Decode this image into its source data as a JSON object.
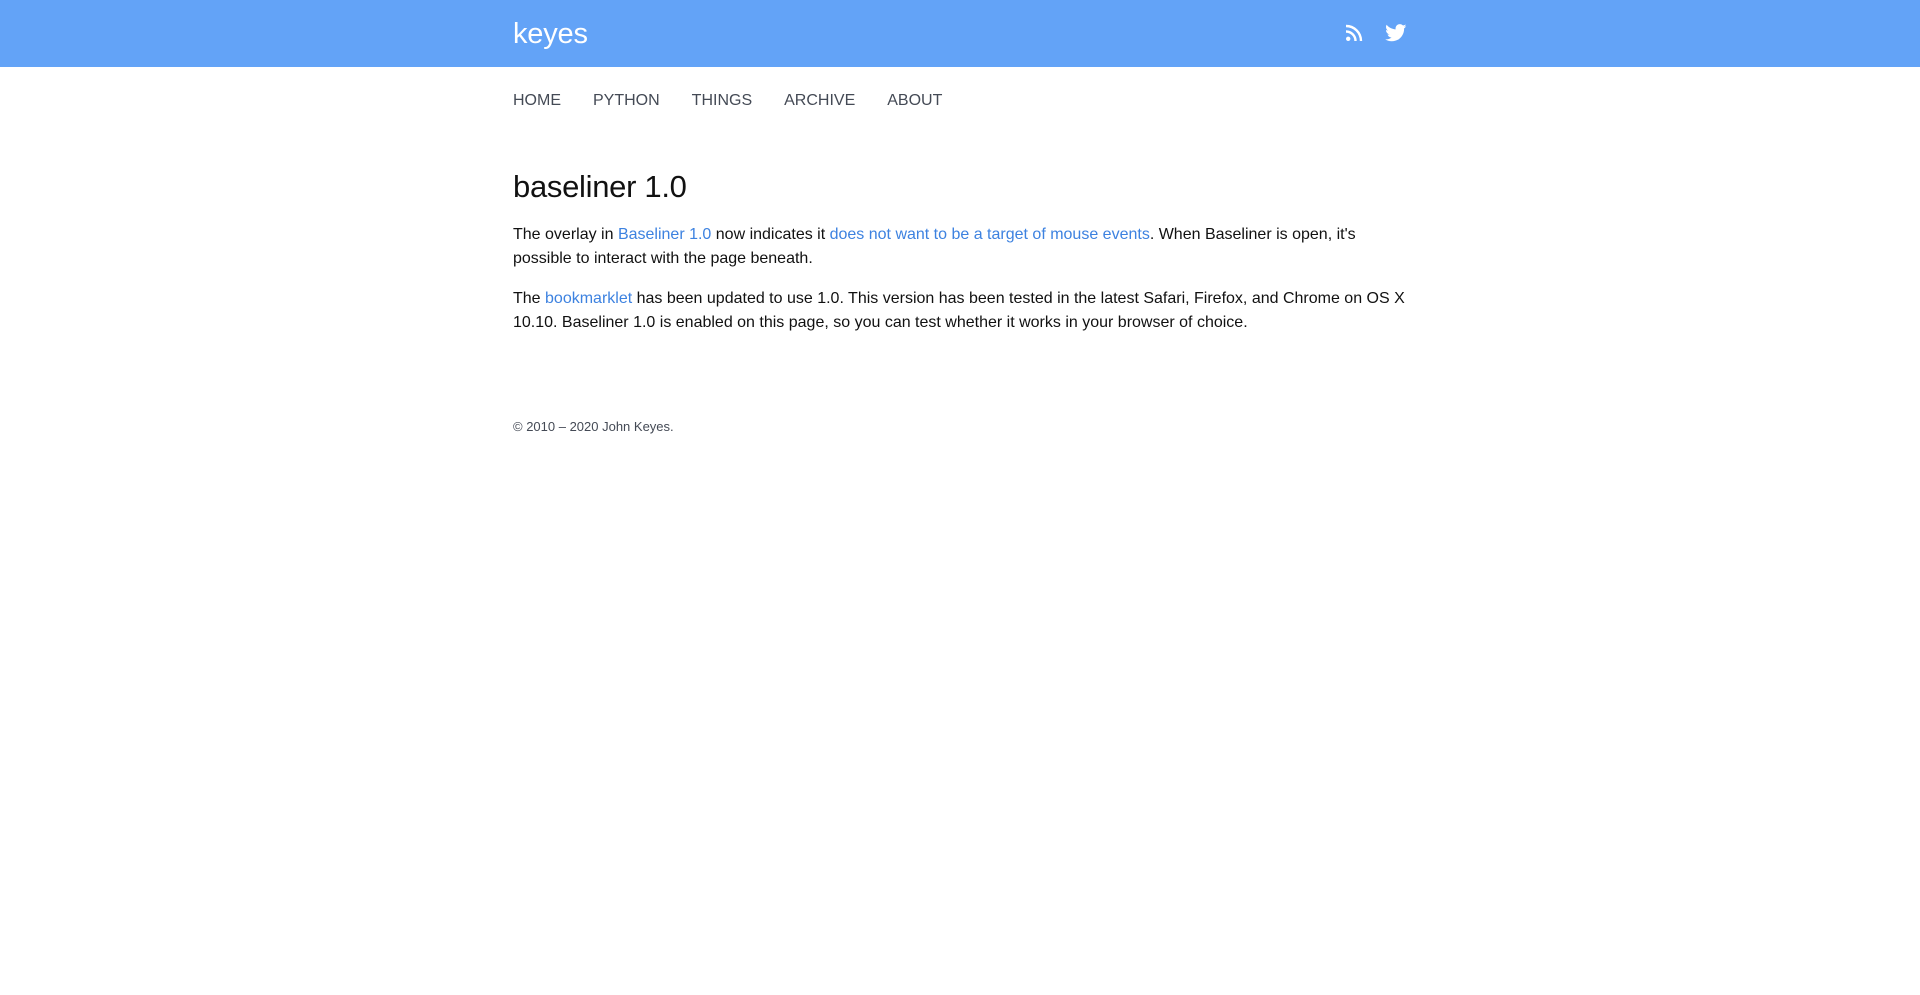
{
  "header": {
    "site_title": "keyes",
    "icons": [
      "rss-icon",
      "twitter-icon"
    ],
    "background_color": "#63a3f7"
  },
  "nav": {
    "items": [
      {
        "label": "HOME"
      },
      {
        "label": "PYTHON"
      },
      {
        "label": "THINGS"
      },
      {
        "label": "ARCHIVE"
      },
      {
        "label": "ABOUT"
      }
    ]
  },
  "article": {
    "title": "baseliner 1.0",
    "p1": {
      "t1": "The overlay in ",
      "link1": "Baseliner 1.0",
      "t2": " now indicates it ",
      "link2": "does not want to be a target of mouse events",
      "t3": ". When Baseliner is open, it's possible to interact with the page beneath."
    },
    "p2": {
      "t1": "The ",
      "link1": "bookmarklet",
      "t2": " has been updated to use 1.0. This version has been tested in the latest Safari, Firefox, and Chrome on OS X 10.10. Baseliner 1.0 is enabled on this page, so you can test whether it works in your browser of choice."
    },
    "link_color": "#3d82e0"
  },
  "footer": {
    "copyright": "© 2010 – 2020 John Keyes."
  }
}
